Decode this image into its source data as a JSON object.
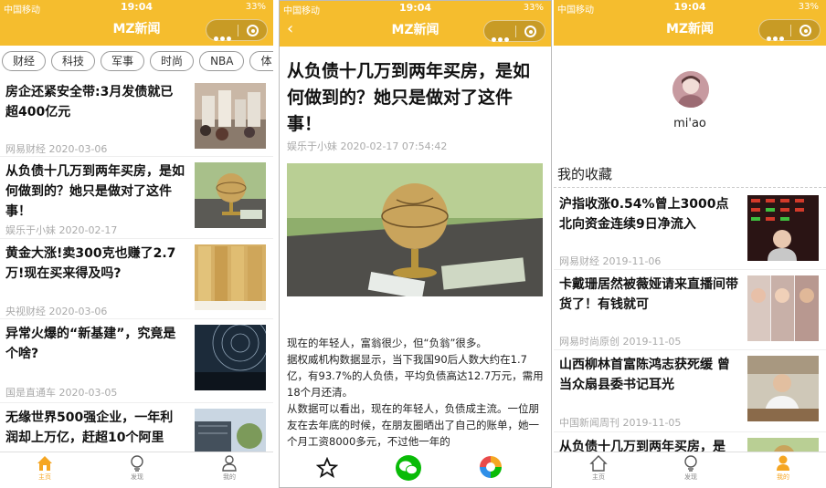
{
  "status": {
    "carrier": "中国移动",
    "time": "19:04",
    "battery": "33%"
  },
  "app_title": "MZ新闻",
  "home": {
    "tags": [
      "财经",
      "科技",
      "军事",
      "时尚",
      "NBA",
      "体"
    ],
    "news": [
      {
        "title": "房企还紧安全带:3月发债就已超400亿元",
        "source": "网易财经",
        "date": "2020-03-06"
      },
      {
        "title": "从负债十几万到两年买房，是如何做到的？她只是做对了这件事！",
        "source": "娱乐于小妹",
        "date": "2020-02-17"
      },
      {
        "title": "黄金大涨!卖300克也赚了2.7万!现在买来得及吗?",
        "source": "央视财经",
        "date": "2020-03-06"
      },
      {
        "title": "异常火爆的“新基建”，究竟是个啥?",
        "source": "国是直通车",
        "date": "2020-03-05"
      },
      {
        "title": "无缘世界500强企业，一年利润却上万亿，赶超10个阿里",
        "source": "",
        "date": ""
      }
    ]
  },
  "tabs": {
    "home": "主页",
    "discover": "发现",
    "mine": "我的"
  },
  "article": {
    "title": "从负债十几万到两年买房，是如何做到的？她只是做对了这件事！",
    "meta": "娱乐于小妹 2020-02-17 07:54:42",
    "paragraphs": [
      "现在的年轻人，富翁很少，但“负翁”很多。",
      "据权威机构数据显示，当下我国90后人数大约在1.7亿，有93.7%的人负债，平均负债高达12.7万元，需用18个月还清。",
      "从数据可以看出，现在的年轻人，负债成主流。一位朋友在去年底的时候，在朋友圈晒出了自己的账单，她一个月工资8000多元，不过他一年的"
    ]
  },
  "profile": {
    "username": "mi'ao",
    "favorites_title": "我的收藏",
    "favorites": [
      {
        "title": "沪指收涨0.54%曾上3000点北向资金连续9日净流入",
        "source": "网易财经",
        "date": "2019-11-06"
      },
      {
        "title": "卡戴珊居然被薇娅请来直播间带货了！有钱就可",
        "source": "网易时尚原创",
        "date": "2019-11-05"
      },
      {
        "title": "山西柳林首富陈鸿志获死缓 曾当众扇县委书记耳光",
        "source": "中国新闻周刊",
        "date": "2019-11-05"
      },
      {
        "title": "从负债十几万到两年买房，是",
        "source": "",
        "date": ""
      }
    ]
  },
  "colors": {
    "brand": "#f5bd2e",
    "tab_active": "#f5a623",
    "wechat": "#09bb07"
  }
}
